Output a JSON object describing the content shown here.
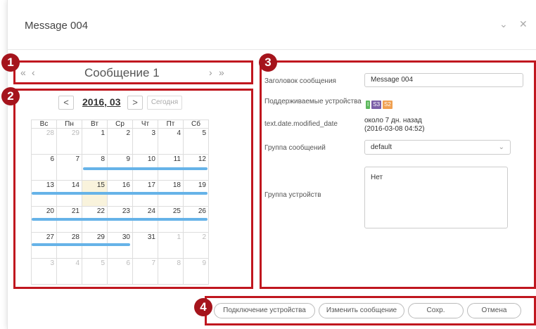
{
  "window": {
    "title": "Message 004"
  },
  "annotations": [
    "1",
    "2",
    "3",
    "4"
  ],
  "nav": {
    "title": "Сообщение 1"
  },
  "calendar": {
    "month_label": "2016, 03",
    "prev_label": "<",
    "next_label": ">",
    "today_label": "Сегодня",
    "weekdays": [
      "Вс",
      "Пн",
      "Вт",
      "Ср",
      "Чт",
      "Пт",
      "Сб"
    ],
    "weeks": [
      [
        "28",
        "29",
        "1",
        "2",
        "3",
        "4",
        "5"
      ],
      [
        "6",
        "7",
        "8",
        "9",
        "10",
        "11",
        "12"
      ],
      [
        "13",
        "14",
        "15",
        "16",
        "17",
        "18",
        "19"
      ],
      [
        "20",
        "21",
        "22",
        "23",
        "24",
        "25",
        "26"
      ],
      [
        "27",
        "28",
        "29",
        "30",
        "31",
        "1",
        "2"
      ],
      [
        "3",
        "4",
        "5",
        "6",
        "7",
        "8",
        "9"
      ]
    ]
  },
  "details": {
    "title_label": "Заголовок сообщения",
    "title_value": "Message 004",
    "devices_label": "Поддерживаемые устройства",
    "device_badges": [
      {
        "text": "I",
        "color": "#5cb85c"
      },
      {
        "text": "S3",
        "color": "#7b5ea7"
      },
      {
        "text": "S2",
        "color": "#f0a050"
      }
    ],
    "modified_label": "text.date.modified_date",
    "modified_value_1": "около 7 дн. назад",
    "modified_value_2": "(2016-03-08 04:52)",
    "group_label": "Группа сообщений",
    "group_value": "default",
    "device_group_label": "Группа устройств",
    "device_group_value": "Нет"
  },
  "buttons": {
    "connect": "Подключение устройства",
    "edit": "Изменить сообщение",
    "save": "Сохр.",
    "cancel": "Отмена"
  },
  "colors": {
    "annotation": "#c0171f",
    "event_bar": "#66b3e8",
    "today_cell": "#f9f3dc"
  }
}
